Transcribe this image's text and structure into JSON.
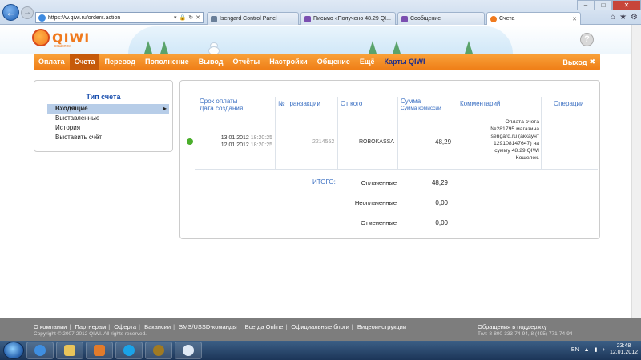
{
  "browser": {
    "url": "https://w.qiwi.ru/orders.action",
    "tabs": [
      {
        "label": "Isengard Control Panel",
        "active": false
      },
      {
        "label": "Письмо «Получено 48.29 QI...",
        "active": false
      },
      {
        "label": "Сообщение",
        "active": false
      },
      {
        "label": "Счета",
        "active": true
      }
    ]
  },
  "header": {
    "logo_text": "QIWI",
    "logo_sub": "кошелек"
  },
  "nav": {
    "items": [
      "Оплата",
      "Счета",
      "Перевод",
      "Пополнение",
      "Вывод",
      "Отчёты",
      "Настройки",
      "Общение",
      "Ещё"
    ],
    "special": "Карты QIWI",
    "exit": "Выход"
  },
  "left_panel": {
    "title": "Тип счета",
    "items": [
      "Входящие",
      "Выставленные",
      "История",
      "Выставить счёт"
    ]
  },
  "table": {
    "headers": {
      "due_date": "Срок оплаты",
      "created": "Дата создания",
      "transaction": "№ транзакции",
      "from": "От кого",
      "sum": "Сумма",
      "commission": "Сумма комиссии",
      "comment": "Комментарий",
      "operations": "Операции"
    },
    "row": {
      "due_date": "13.01.2012",
      "due_time": "18:20:25",
      "created_date": "12.01.2012",
      "created_time": "18:20:25",
      "transaction": "2214552",
      "from": "ROBOKASSA",
      "sum": "48,29",
      "comment_lines": [
        "Оплата счета",
        "№281795 магазина",
        "Isengard.ru (аккаунт",
        "129108147647) на",
        "сумму 48.29 QIWI",
        "Кошелек."
      ]
    }
  },
  "totals": {
    "label": "ИТОГО:",
    "paid_label": "Оплаченные",
    "paid_value": "48,29",
    "unpaid_label": "Неоплаченные",
    "unpaid_value": "0,00",
    "cancelled_label": "Отмененные",
    "cancelled_value": "0,00"
  },
  "footer": {
    "links": [
      "О компании",
      "Партнерам",
      "Оферта",
      "Вакансии",
      "SMS/USSD-команды",
      "Всегда Online",
      "Официальные блоги",
      "Видеоинструкции"
    ],
    "copyright": "Copyright © 2007-2012 QIWI. All rights reserved.",
    "support": "Обращения в поддержку",
    "phones": "Тел: 8-800-333-74-94, 8 (495) 771-74-94"
  },
  "taskbar": {
    "lang": "EN",
    "time": "23:48",
    "date": "12.01.2012"
  },
  "colors": {
    "accent_orange": "#ef7d16",
    "link_blue": "#3a6fc2",
    "status_green": "#4aae2b"
  }
}
